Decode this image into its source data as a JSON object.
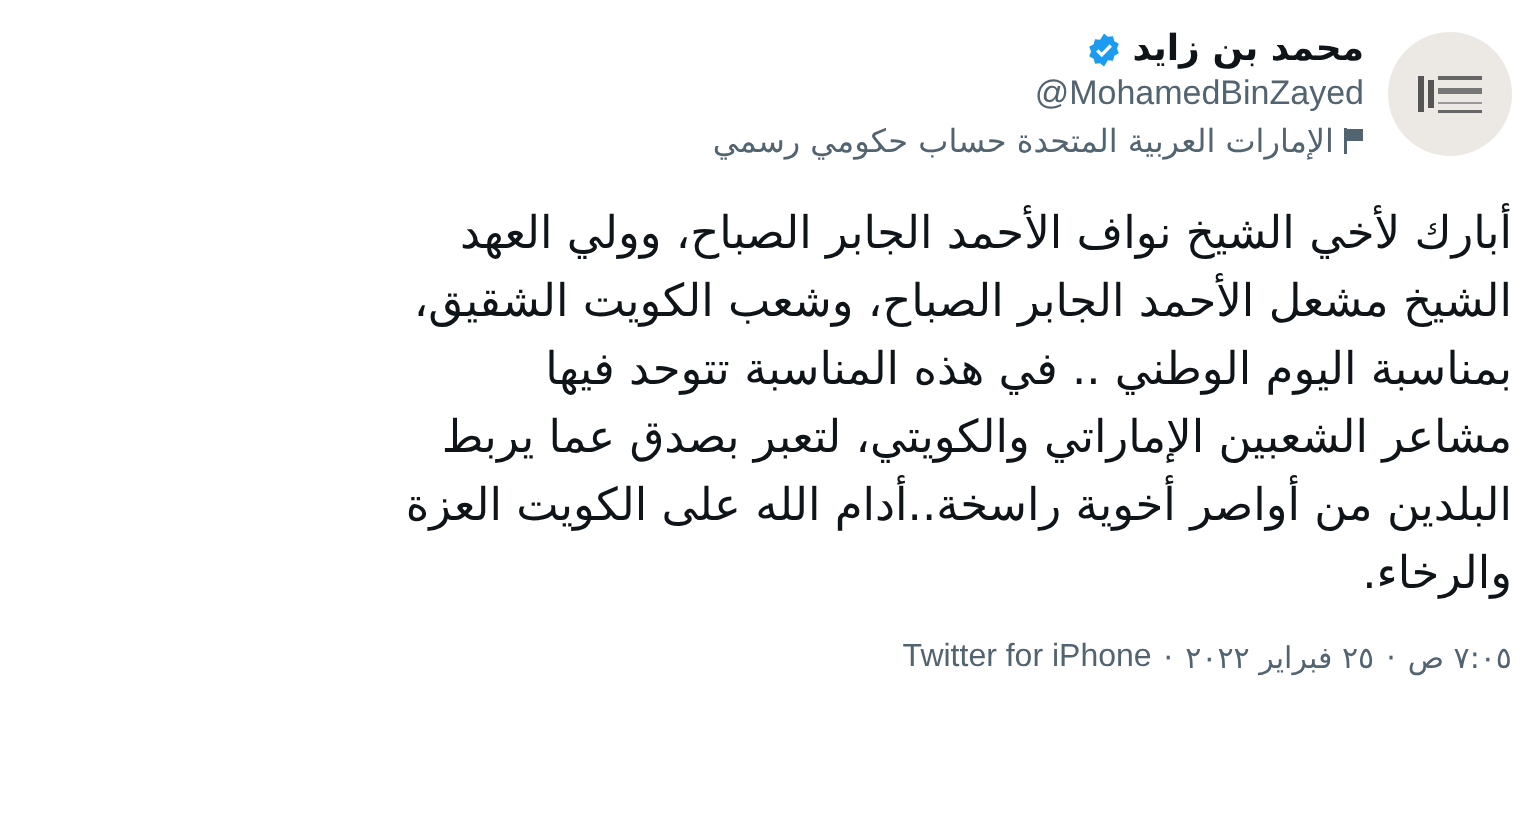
{
  "author": {
    "name": "محمد بن زايد",
    "verified": true,
    "handle": "@MohamedBinZayed",
    "label": "الإمارات العربية المتحدة حساب حكومي رسمي"
  },
  "tweet": {
    "text": "أبارك لأخي الشيخ نواف الأحمد الجابر الصباح، وولي العهد\nالشيخ مشعل الأحمد الجابر الصباح، وشعب الكويت الشقيق،\nبمناسبة اليوم الوطني .. في هذه المناسبة تتوحد فيها\nمشاعر الشعبين  الإماراتي والكويتي، لتعبر بصدق عما يربط\nالبلدين من أواصر أخوية راسخة..أدام الله على الكويت العزة\nوالرخاء."
  },
  "footer": {
    "time": "٧:٠٥ ص",
    "date": "٢٥ فبراير ٢٠٢٢",
    "source": "Twitter for iPhone",
    "separator": "·"
  }
}
